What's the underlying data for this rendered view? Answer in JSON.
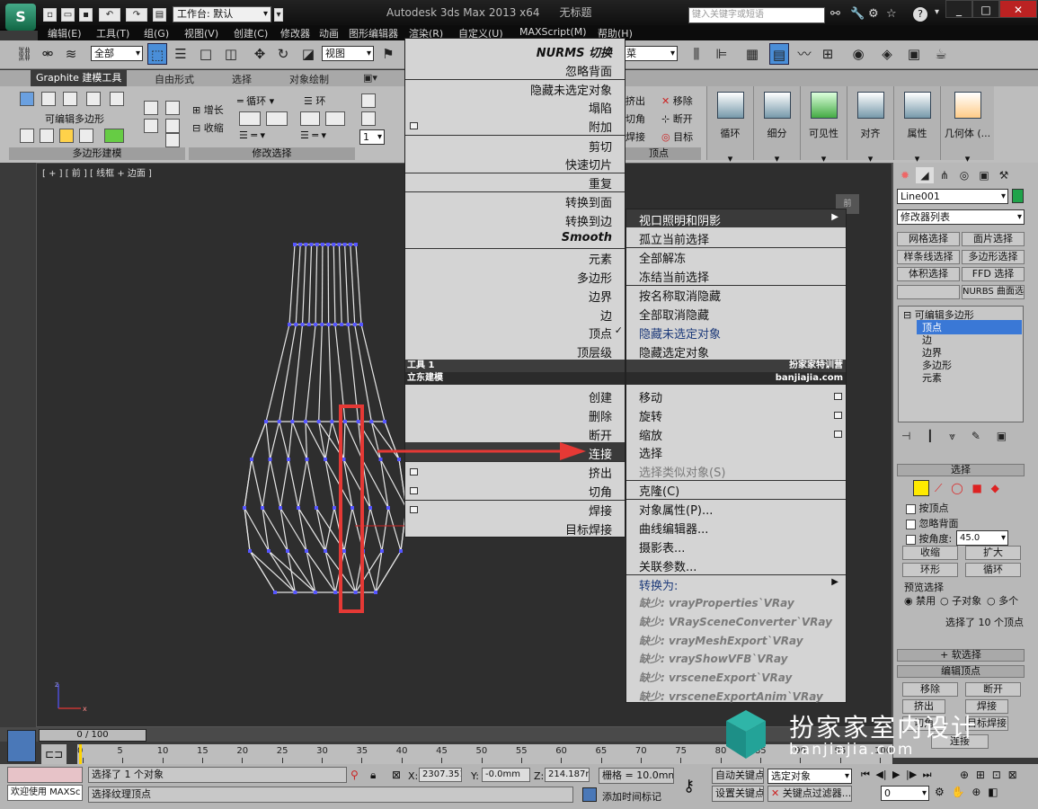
{
  "titlebar": {
    "app_title": "Autodesk 3ds Max  2013 x64",
    "doc_title": "无标题",
    "workspace": "工作台: 默认",
    "search_placeholder": "键入关键字或短语"
  },
  "menus": [
    "编辑(E)",
    "工具(T)",
    "组(G)",
    "视图(V)",
    "创建(C)",
    "修改器",
    "动画",
    "图形编辑器",
    "渲染(R)",
    "自定义(U)",
    "MAXScript(M)",
    "帮助(H)"
  ],
  "toolbar": {
    "selection_filter": "全部",
    "ref_coord": "视图",
    "named_sets": "菜"
  },
  "ribbon": {
    "tabs": [
      "Graphite 建模工具",
      "自由形式",
      "选择",
      "对象绘制"
    ],
    "panel_labels": [
      "多边形建模",
      "修改选择",
      "顶点"
    ],
    "editable_poly": "可编辑多边形",
    "grow": "增长",
    "shrink": "收缩",
    "loop": "循环",
    "ring": "环",
    "extrude": "挤出",
    "chamfer": "切角",
    "weld": "焊接",
    "remove": "移除",
    "break": "断开",
    "target": "目标",
    "spin_value": "1",
    "big_buttons": [
      "循环",
      "细分",
      "可见性",
      "对齐",
      "属性",
      "几何体 (..."
    ]
  },
  "viewport": {
    "label": "[ + ] [ 前 ] [ 线框 + 边面 ]",
    "cube": "前"
  },
  "quad_left": {
    "items": [
      "NURMS 切换",
      "忽略背面",
      "隐藏未选定对象",
      "塌陷",
      "附加",
      "剪切",
      "快速切片",
      "重复",
      "转换到面",
      "转换到边",
      "Smooth",
      "元素",
      "多边形",
      "边界",
      "边",
      "顶点",
      "顶层级"
    ],
    "header1_left": "工具 1",
    "header2_left": "立东建模",
    "items2": [
      "创建",
      "删除",
      "断开",
      "连接",
      "挤出",
      "切角",
      "焊接",
      "目标焊接"
    ]
  },
  "quad_right": {
    "items": [
      "视口照明和阴影",
      "孤立当前选择",
      "全部解冻",
      "冻结当前选择",
      "按名称取消隐藏",
      "全部取消隐藏",
      "隐藏未选定对象",
      "隐藏选定对象"
    ],
    "header1_right": "扮家家特训营",
    "header2_right": "banjiajia.com",
    "items2": [
      "移动",
      "旋转",
      "缩放",
      "选择",
      "选择类似对象(S)",
      "克隆(C)",
      "对象属性(P)...",
      "曲线编辑器...",
      "摄影表...",
      "关联参数...",
      "转换为:",
      "缺少: vrayProperties`VRay",
      "缺少: VRaySceneConverter`VRay",
      "缺少: vrayMeshExport`VRay",
      "缺少: vrayShowVFB`VRay",
      "缺少: vrsceneExport`VRay",
      "缺少: vrsceneExportAnim`VRay"
    ]
  },
  "command_panel": {
    "object_name": "Line001",
    "modifier_list": "修改器列表",
    "buttons": [
      "网格选择",
      "面片选择",
      "样条线选择",
      "多边形选择",
      "体积选择",
      "FFD 选择",
      "",
      "NURBS 曲面选择"
    ],
    "stack": [
      "可编辑多边形",
      "顶点",
      "边",
      "边界",
      "多边形",
      "元素"
    ],
    "selection_title": "选择",
    "by_vertex": "按顶点",
    "ignore_backface": "忽略背面",
    "by_angle": "按角度:",
    "angle_value": "45.0",
    "shrink": "收缩",
    "grow": "扩大",
    "ring": "环形",
    "loop": "循环",
    "preview_selection": "预览选择",
    "disable": "禁用",
    "subobject": "子对象",
    "multi": "多个",
    "selected_info": "选择了 10 个顶点",
    "soft_selection": "软选择",
    "edit_vertices": "编辑顶点",
    "remove": "移除",
    "break": "断开",
    "extrude": "挤出",
    "weld": "焊接",
    "chamfer": "切角",
    "target_weld": "目标焊接",
    "connect": "连接"
  },
  "timeline": {
    "slider": "0 / 100",
    "ticks": [
      "0",
      "5",
      "10",
      "15",
      "20",
      "25",
      "30",
      "35",
      "40",
      "45",
      "50",
      "55",
      "60",
      "65",
      "70",
      "75",
      "80",
      "85",
      "90",
      "95",
      "100"
    ]
  },
  "status": {
    "welcome": "欢迎使用 MAXSc",
    "selected": "选择了 1 个对象",
    "prompt": "选择纹理顶点",
    "x": "2307.351m",
    "y": "-0.0mm",
    "z": "214.187mm",
    "grid": "栅格 = 10.0mm",
    "add_time_tag": "添加时间标记",
    "auto_key": "自动关键点",
    "set_key": "设置关键点",
    "selected_obj": "选定对象",
    "key_filters": "关键点过滤器...",
    "frame": "0"
  },
  "watermark": {
    "line1": "扮家家室内设计",
    "line2": "banjiajia.com"
  },
  "colors": {
    "highlight_red": "#e53935",
    "vertex_blue": "#5555ff",
    "wire": "#e6e6e6"
  }
}
